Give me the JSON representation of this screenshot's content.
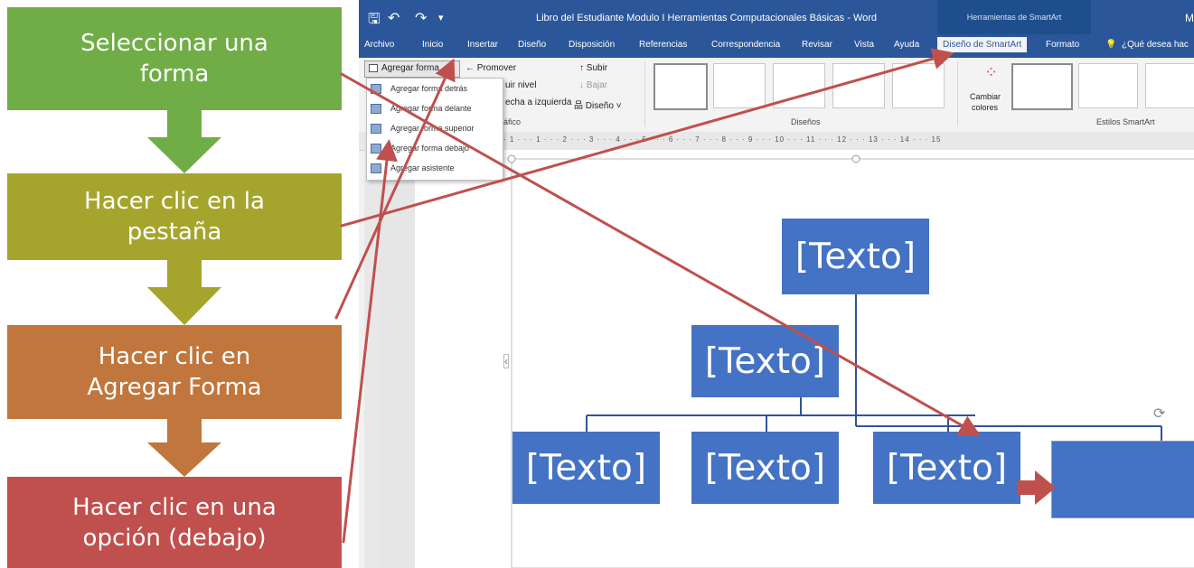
{
  "steps": [
    {
      "lines": [
        "Seleccionar una",
        "forma"
      ],
      "color": "#70ad47"
    },
    {
      "lines": [
        "Hacer clic en la",
        "pestaña"
      ],
      "color": "#a5a52e"
    },
    {
      "lines": [
        "Hacer clic en",
        "Agregar Forma"
      ],
      "color": "#c0763c"
    },
    {
      "lines": [
        "Hacer clic en una",
        "opción (debajo)"
      ],
      "color": "#c0504d"
    }
  ],
  "word": {
    "doc_title": "Libro del Estudiante Modulo I Herramientas Computacionales Básicas  -  Word",
    "context_title": "Herramientas de SmartArt",
    "user_initial": "M",
    "tabs": [
      "Archivo",
      "Inicio",
      "Insertar",
      "Diseño",
      "Disposición",
      "Referencias",
      "Correspondencia",
      "Revisar",
      "Vista",
      "Ayuda",
      "Diseño de SmartArt",
      "Formato",
      "¿Qué desea hac"
    ],
    "ribbon": {
      "agregar_forma": "Agregar forma",
      "promover": "Promover",
      "subir": "Subir",
      "bajar": "Bajar",
      "nivel": "uir nivel",
      "izquierda": "echa a izquierda",
      "diseno": "Diseño",
      "grafico_group": "áfico",
      "disenos_group": "Diseños",
      "cambiar": "Cambiar",
      "colores": "colores",
      "estilos_group": "Estilos SmartArt"
    },
    "menu": [
      "Agregar forma detrás",
      "Agregar forma delante",
      "Agregar forma superior",
      "Agregar forma debajo",
      "Agregar asistente"
    ],
    "ruler": "· 1 · · · 1 · · · 2 · · · 3 · · · 4 · · · 5 · · · 6 · · · 7 · · · 8 · · · 9 · · · 10 · · · 11 · · · 12 · · · 13 · · · 14 · · · 15",
    "smartart": [
      "[Texto]",
      "[Texto]",
      "[Texto]",
      "[Texto]",
      "[Texto]"
    ]
  },
  "colors": {
    "word_blue": "#2b579a",
    "smartart_blue": "#4472c4",
    "arrow_red": "#c0504d"
  }
}
